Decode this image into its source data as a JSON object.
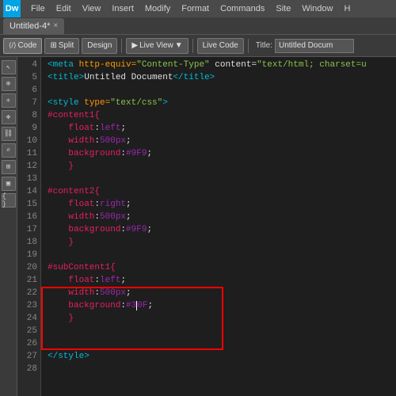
{
  "titlebar": {
    "logo": "Dw",
    "menus": [
      "File",
      "Edit",
      "View",
      "Insert",
      "Modify",
      "Format",
      "Commands",
      "Site",
      "Window",
      "H"
    ]
  },
  "tab": {
    "label": "Untitled-4*",
    "close": "×"
  },
  "toolbar": {
    "code_btn": "Code",
    "split_btn": "Split",
    "design_btn": "Design",
    "live_view_btn": "Live View",
    "live_code_btn": "Live Code",
    "title_label": "Title:",
    "title_value": "Untitled Docum"
  },
  "code": {
    "lines": [
      {
        "num": "4",
        "content": "meta_http"
      },
      {
        "num": "5",
        "content": "title"
      },
      {
        "num": "6",
        "content": ""
      },
      {
        "num": "7",
        "content": "style_tag"
      },
      {
        "num": "8",
        "content": "content1_open"
      },
      {
        "num": "9",
        "content": "float_left"
      },
      {
        "num": "10",
        "content": "width_500"
      },
      {
        "num": "11",
        "content": "bg_9f9"
      },
      {
        "num": "12",
        "content": "close_brace"
      },
      {
        "num": "13",
        "content": ""
      },
      {
        "num": "14",
        "content": "content2_open"
      },
      {
        "num": "15",
        "content": "float_right"
      },
      {
        "num": "16",
        "content": "width_500_2"
      },
      {
        "num": "17",
        "content": "bg_9f9_2"
      },
      {
        "num": "18",
        "content": "close_brace2"
      },
      {
        "num": "19",
        "content": ""
      },
      {
        "num": "20",
        "content": "subcontent1_open"
      },
      {
        "num": "21",
        "content": "float_left2"
      },
      {
        "num": "22",
        "content": "width_500_3"
      },
      {
        "num": "23",
        "content": "bg_30f"
      },
      {
        "num": "24",
        "content": "close_brace3"
      },
      {
        "num": "25",
        "content": ""
      },
      {
        "num": "26",
        "content": ""
      },
      {
        "num": "27",
        "content": "style_close"
      },
      {
        "num": "28",
        "content": ""
      }
    ]
  },
  "icons": {
    "code_icon": "⟨/⟩",
    "split_icon": "⊞",
    "design_icon": "✦",
    "live_icon": "▶",
    "arrow_icon": "▼"
  }
}
